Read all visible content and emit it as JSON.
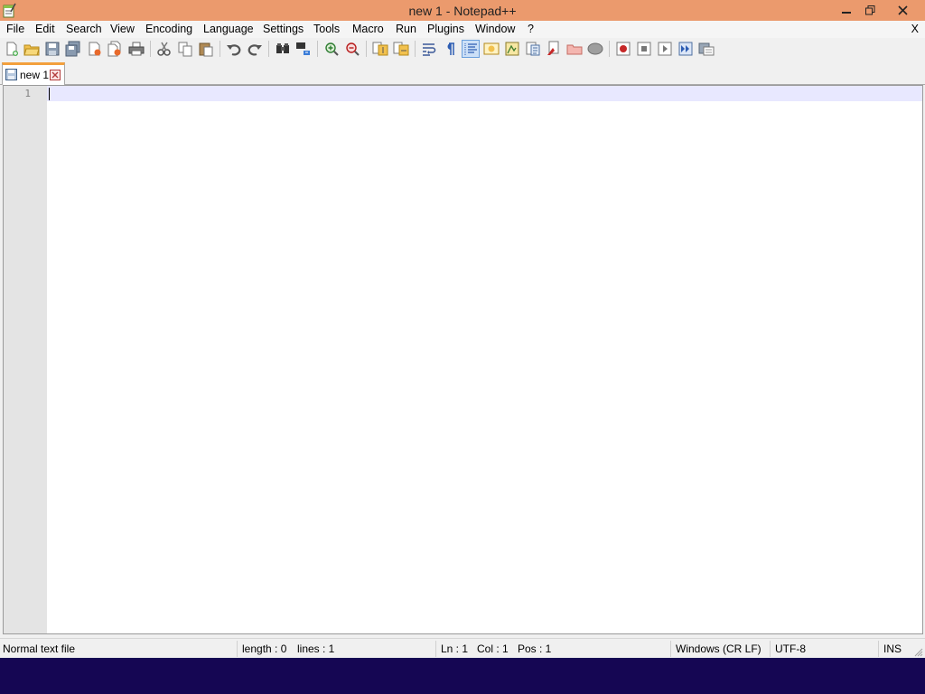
{
  "window": {
    "title": "new 1 - Notepad++",
    "close_glyph": "✕",
    "restore_glyph": "❐",
    "minimize_glyph": "—"
  },
  "menu": {
    "items": [
      "File",
      "Edit",
      "Search",
      "View",
      "Encoding",
      "Language",
      "Settings",
      "Tools",
      "Macro",
      "Run",
      "Plugins",
      "Window",
      "?"
    ],
    "close_doc": "X"
  },
  "toolbar": {
    "buttons": [
      {
        "name": "new-file-icon",
        "title": "New"
      },
      {
        "name": "open-file-icon",
        "title": "Open"
      },
      {
        "name": "save-icon",
        "title": "Save"
      },
      {
        "name": "save-all-icon",
        "title": "Save All"
      },
      {
        "name": "close-icon",
        "title": "Close"
      },
      {
        "name": "close-all-icon",
        "title": "Close All"
      },
      {
        "name": "print-icon",
        "title": "Print"
      },
      {
        "name": "cut-icon",
        "title": "Cut"
      },
      {
        "name": "copy-icon",
        "title": "Copy"
      },
      {
        "name": "paste-icon",
        "title": "Paste"
      },
      {
        "name": "undo-icon",
        "title": "Undo"
      },
      {
        "name": "redo-icon",
        "title": "Redo"
      },
      {
        "name": "find-icon",
        "title": "Find"
      },
      {
        "name": "replace-icon",
        "title": "Replace"
      },
      {
        "name": "zoom-in-icon",
        "title": "Zoom In"
      },
      {
        "name": "zoom-out-icon",
        "title": "Zoom Out"
      },
      {
        "name": "sync-vertical-icon",
        "title": "Synchronize Vertical Scrolling"
      },
      {
        "name": "sync-horizontal-icon",
        "title": "Synchronize Horizontal Scrolling"
      },
      {
        "name": "word-wrap-icon",
        "title": "Word wrap"
      },
      {
        "name": "show-all-chars-icon",
        "title": "Show All Characters"
      },
      {
        "name": "indent-guide-icon",
        "title": "Show Indent Guide"
      },
      {
        "name": "user-language-icon",
        "title": "Define your language"
      },
      {
        "name": "document-map-icon",
        "title": "Document Map"
      },
      {
        "name": "function-list-icon",
        "title": "Function List"
      },
      {
        "name": "folder-workspace-icon",
        "title": "Folder as Workspace"
      },
      {
        "name": "monitoring-icon",
        "title": "Monitoring"
      },
      {
        "name": "record-macro-icon",
        "title": "Start Recording"
      },
      {
        "name": "stop-macro-icon",
        "title": "Stop Recording"
      },
      {
        "name": "play-macro-icon",
        "title": "Playback"
      },
      {
        "name": "run-macro-multiple-icon",
        "title": "Run a Macro Multiple Times"
      },
      {
        "name": "save-macro-icon",
        "title": "Save Current Recorded Macro"
      }
    ]
  },
  "tabs": [
    {
      "label": "new 1",
      "active": true
    }
  ],
  "editor": {
    "line_numbers": [
      "1"
    ],
    "content": ""
  },
  "status": {
    "file_type": "Normal text file",
    "length": "length : 0",
    "lines": "lines : 1",
    "ln": "Ln : 1",
    "col": "Col : 1",
    "pos": "Pos : 1",
    "eol": "Windows (CR LF)",
    "encoding": "UTF-8",
    "mode": "INS"
  },
  "colors": {
    "titlebar": "#eb9a6d",
    "tab_accent": "#f3a03d",
    "current_line": "#e8e8ff",
    "gutter": "#e4e4e4",
    "taskbar": "#150653"
  }
}
